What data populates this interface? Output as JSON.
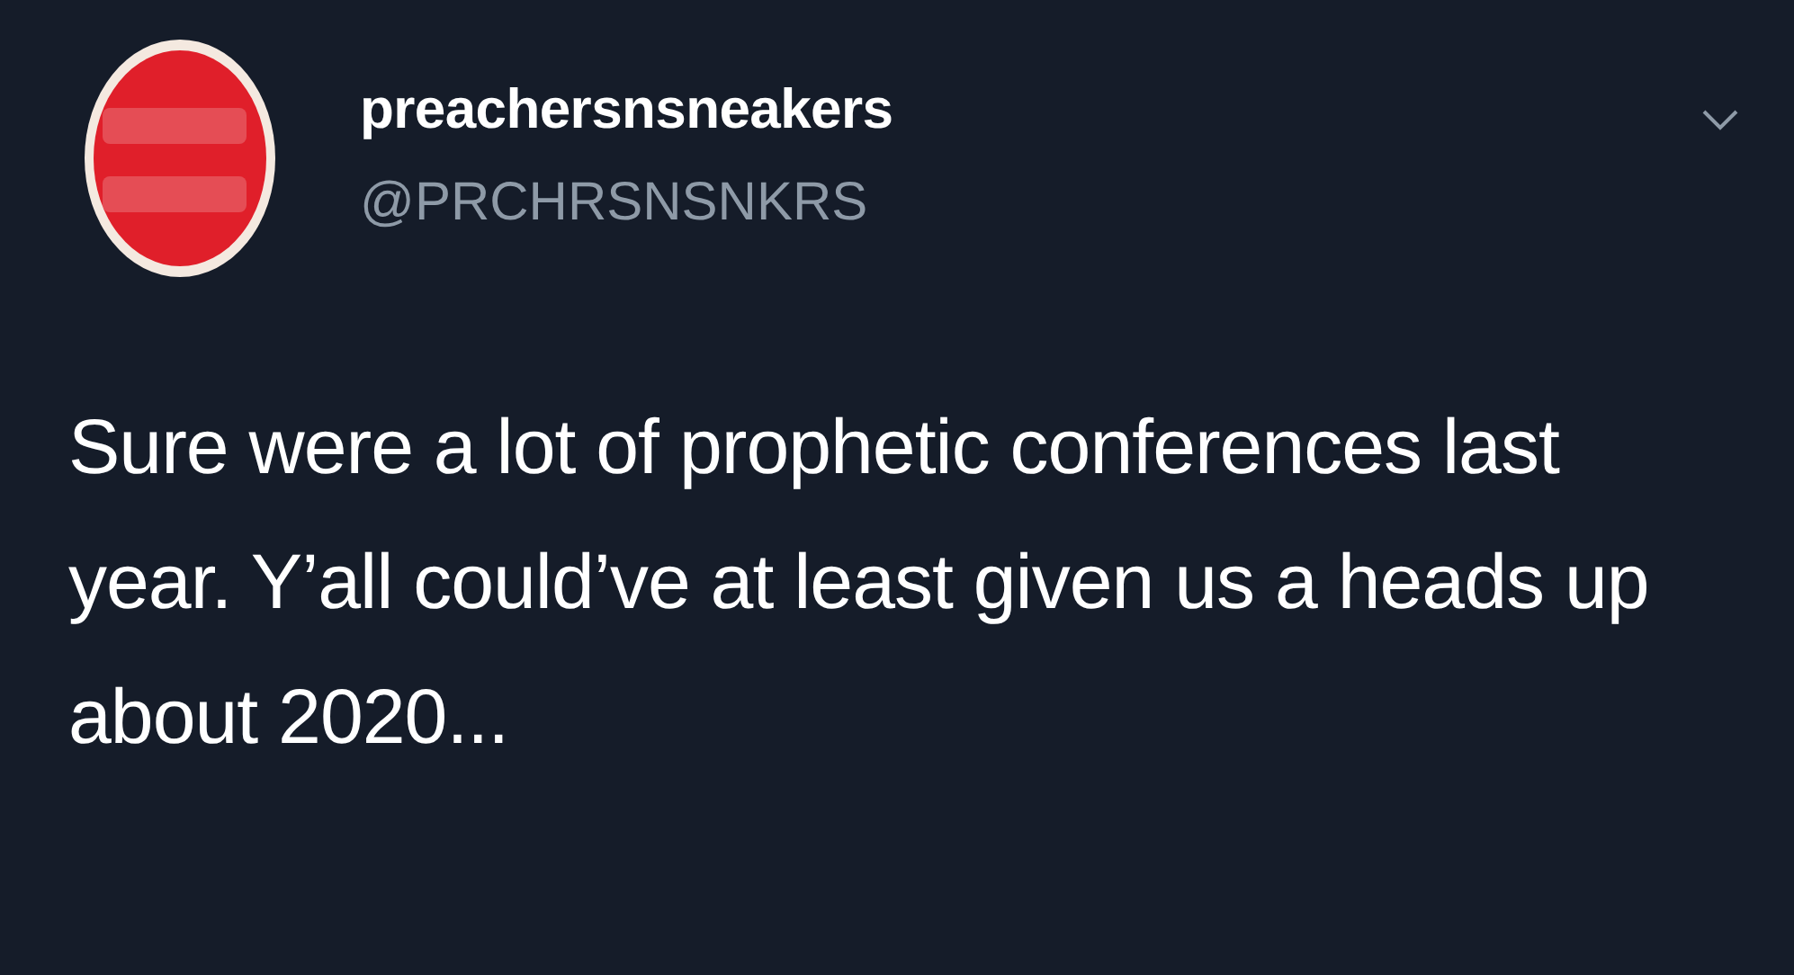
{
  "tweet": {
    "display_name": "preachersnsneakers",
    "handle": "@PRCHRSNSNKRS",
    "text": "Sure were a lot of prophetic conferences last year. Y’all could’ve at least given us a heads up about 2020..."
  }
}
